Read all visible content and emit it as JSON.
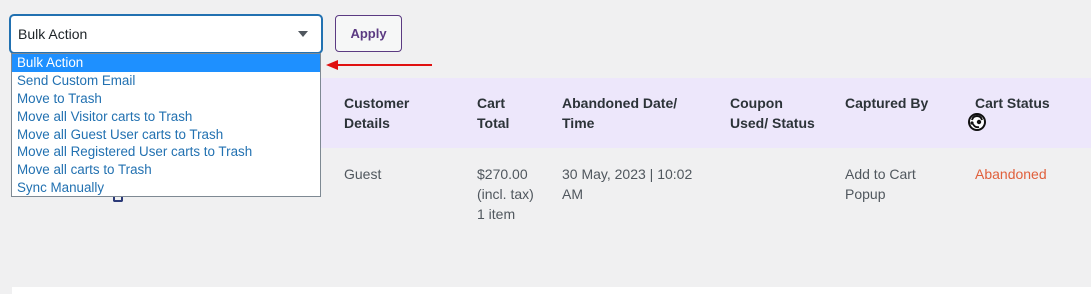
{
  "bulk_action": {
    "selected": "Bulk Action",
    "options": [
      "Bulk Action",
      "Send Custom Email",
      "Move to Trash",
      "Move all Visitor carts to Trash",
      "Move all Guest User carts to Trash",
      "Move all Registered User carts to Trash",
      "Move all carts to Trash",
      "Sync Manually"
    ]
  },
  "apply_label": "Apply",
  "table": {
    "headers": {
      "customer_line1": "Customer",
      "customer_line2": "Details",
      "total_line1": "Cart",
      "total_line2": "Total",
      "date_line1": "Abandoned Date/",
      "date_line2": "Time",
      "coupon_line1": "Coupon",
      "coupon_line2": "Used/ Status",
      "captured": "Captured By",
      "status": "Cart Status"
    },
    "row": {
      "customer": "Guest",
      "total_line1": "$270.00",
      "total_line2": "(incl. tax)",
      "total_line3": "1 item",
      "date_line1": "30 May, 2023 | 10:02",
      "date_line2": "AM",
      "coupon": "",
      "captured_line1": "Add to Cart",
      "captured_line2": "Popup",
      "status": "Abandoned",
      "status_icon": "mailchimp-icon"
    }
  },
  "colors": {
    "accent": "#2271b1",
    "header_bg": "#ede7fb",
    "status_abandoned": "#e0603c",
    "selected_option_bg": "#1e90ff",
    "apply_border": "#5b3a82",
    "annotation_arrow": "#e01010"
  }
}
